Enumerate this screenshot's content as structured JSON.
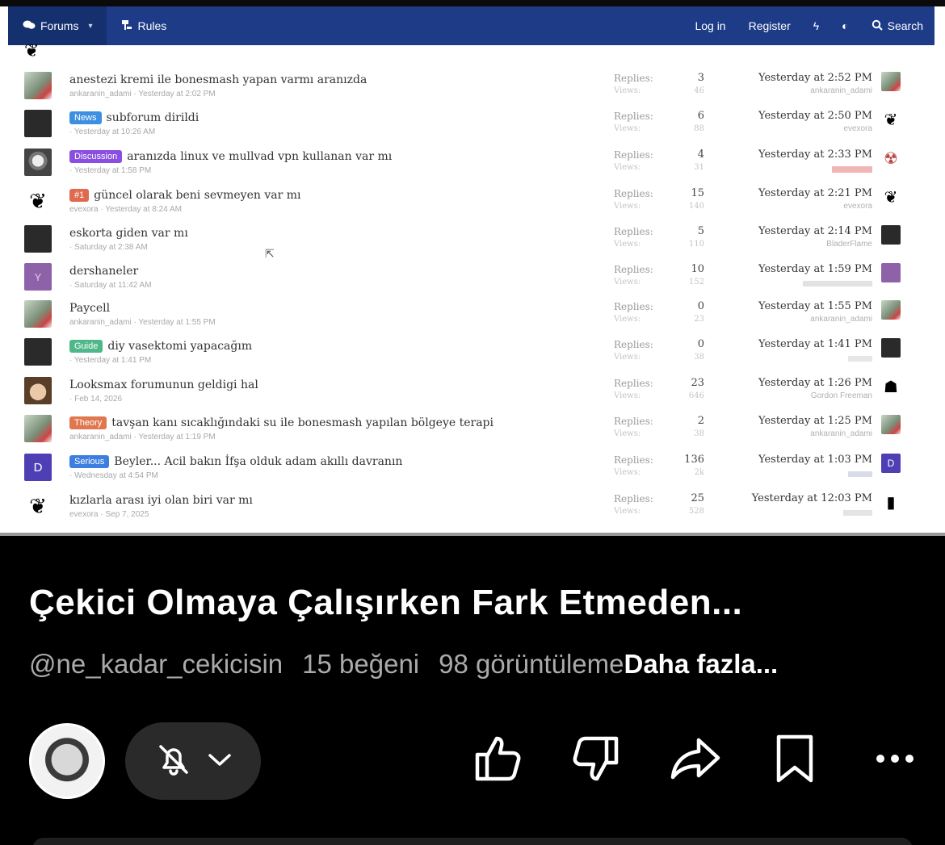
{
  "forum": {
    "nav": {
      "forums_label": "Forums",
      "rules_label": "Rules",
      "login_label": "Log in",
      "register_label": "Register",
      "search_label": "Search"
    },
    "stat_labels": {
      "replies": "Replies:",
      "views": "Views:"
    },
    "threads": [
      {
        "title": "anestezi kremi ile bonesmash yapan varmı aranızda",
        "prefix": "",
        "meta": "ankaranin_adami · Yesterday at 2:02 PM",
        "replies": "3",
        "views": "46",
        "last_date": "Yesterday at 2:52 PM",
        "last_user": "ankaranin_adami"
      },
      {
        "title": "subforum dirildi",
        "prefix": "News",
        "meta": "· Yesterday at 10:26 AM",
        "replies": "6",
        "views": "88",
        "last_date": "Yesterday at 2:50 PM",
        "last_user": "evexora"
      },
      {
        "title": "aranızda linux ve mullvad vpn kullanan var mı",
        "prefix": "Discussion",
        "meta": "· Yesterday at 1:58 PM",
        "replies": "4",
        "views": "31",
        "last_date": "Yesterday at 2:33 PM",
        "last_user": ""
      },
      {
        "title": "güncel olarak beni sevmeyen var mı",
        "prefix": "#1",
        "meta": "evexora · Yesterday at 8:24 AM",
        "replies": "15",
        "views": "140",
        "last_date": "Yesterday at 2:21 PM",
        "last_user": "evexora"
      },
      {
        "title": "eskorta giden var mı",
        "prefix": "",
        "meta": "· Saturday at 2:38 AM",
        "replies": "5",
        "views": "110",
        "last_date": "Yesterday at 2:14 PM",
        "last_user": "BladerFlame"
      },
      {
        "title": "dershaneler",
        "prefix": "",
        "meta": "· Saturday at 11:42 AM",
        "replies": "10",
        "views": "152",
        "last_date": "Yesterday at 1:59 PM",
        "last_user": ""
      },
      {
        "title": "Paycell",
        "prefix": "",
        "meta": "ankaranin_adami · Yesterday at 1:55 PM",
        "replies": "0",
        "views": "23",
        "last_date": "Yesterday at 1:55 PM",
        "last_user": "ankaranin_adami"
      },
      {
        "title": "diy vasektomi yapacağım",
        "prefix": "Guide",
        "meta": "· Yesterday at 1:41 PM",
        "replies": "0",
        "views": "38",
        "last_date": "Yesterday at 1:41 PM",
        "last_user": ""
      },
      {
        "title": "Looksmax forumunun geldigi hal",
        "prefix": "",
        "meta": "· Feb 14, 2026",
        "replies": "23",
        "views": "646",
        "last_date": "Yesterday at 1:26 PM",
        "last_user": "Gordon Freeman"
      },
      {
        "title": "tavşan kanı sıcaklığındaki su ile bonesmash yapılan bölgeye terapi",
        "prefix": "Theory",
        "meta": "ankaranin_adami · Yesterday at 1:19 PM",
        "replies": "2",
        "views": "38",
        "last_date": "Yesterday at 1:25 PM",
        "last_user": "ankaranin_adami"
      },
      {
        "title": "Beyler... Acil bakın İfşa olduk adam akıllı davranın",
        "prefix": "Serious",
        "meta": "· Wednesday at 4:54 PM",
        "replies": "136",
        "views": "2k",
        "last_date": "Yesterday at 1:03 PM",
        "last_user": ""
      },
      {
        "title": "kızlarla arası iyi olan biri var mı",
        "prefix": "",
        "meta": "evexora · Sep 7, 2025",
        "replies": "25",
        "views": "528",
        "last_date": "Yesterday at 12:03 PM",
        "last_user": ""
      }
    ],
    "avatar_letters": {
      "dershaneler": "Y",
      "serious": "D"
    },
    "prefix_colors": {
      "News": "#3d8fe0",
      "Discussion": "#8a4fe0",
      "#1": "#e06a4f",
      "Guide": "#4fb88a",
      "Theory": "#e0784f",
      "Serious": "#3d7fe0"
    }
  },
  "short": {
    "title": "Çekici Olmaya Çalışırken Fark Etmeden...",
    "channel": "@ne_kadar_cekicisin",
    "likes": "15 beğeni",
    "views": "98 görüntüleme",
    "more": "Daha fazla..."
  }
}
